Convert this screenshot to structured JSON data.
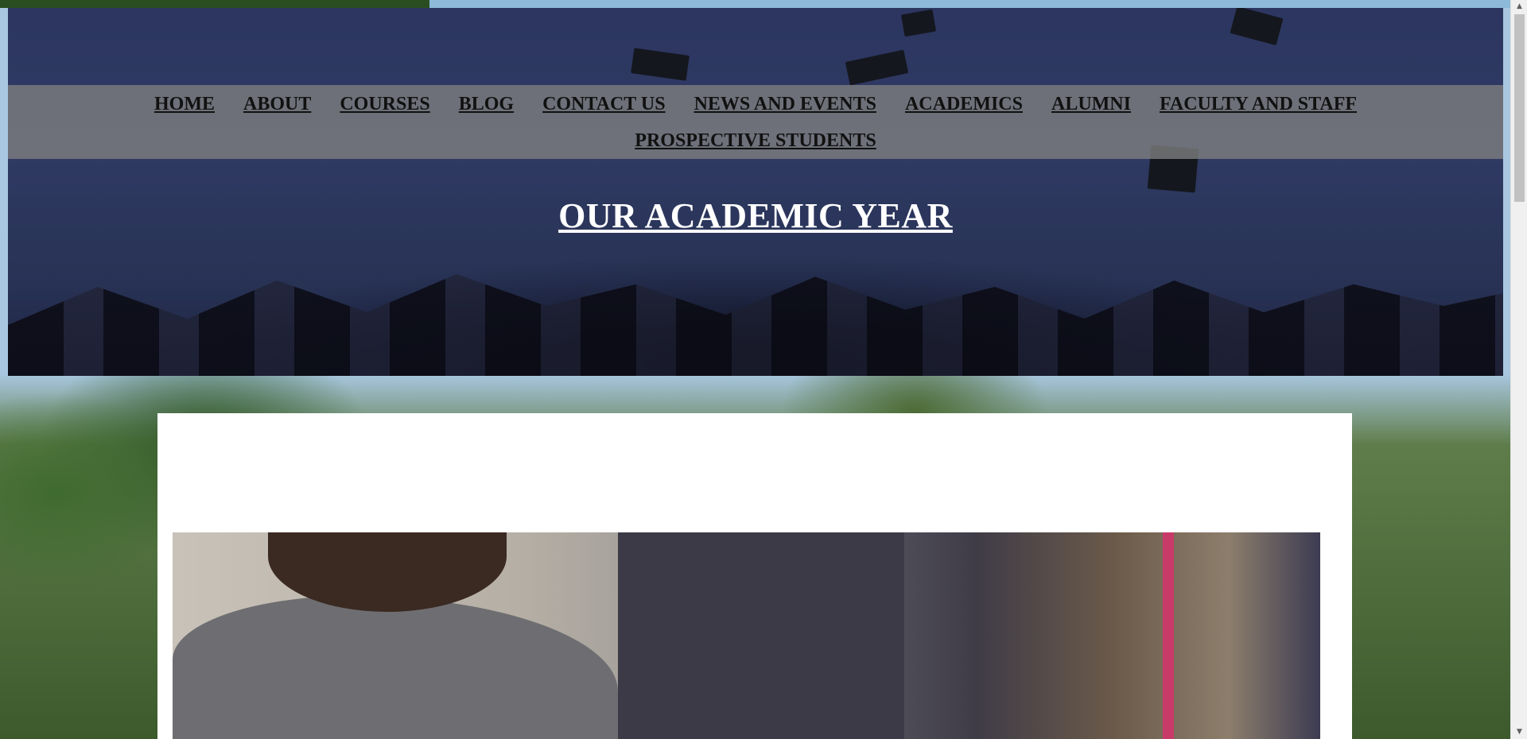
{
  "nav": {
    "items": [
      "HOME",
      "ABOUT",
      "COURSES",
      "BLOG",
      "CONTACT US",
      "NEWS AND EVENTS",
      "ACADEMICS",
      "ALUMNI",
      "FACULTY AND STAFF",
      "PROSPECTIVE STUDENTS"
    ]
  },
  "hero": {
    "title": "OUR ACADEMIC YEAR"
  },
  "icons": {
    "scroll_up": "scroll-up-arrow-icon",
    "scroll_down": "scroll-down-arrow-icon"
  },
  "colors": {
    "nav_bar": "#808080",
    "hero_overlay": "#2c3660",
    "title_text": "#ffffff",
    "nav_text": "#111111"
  }
}
